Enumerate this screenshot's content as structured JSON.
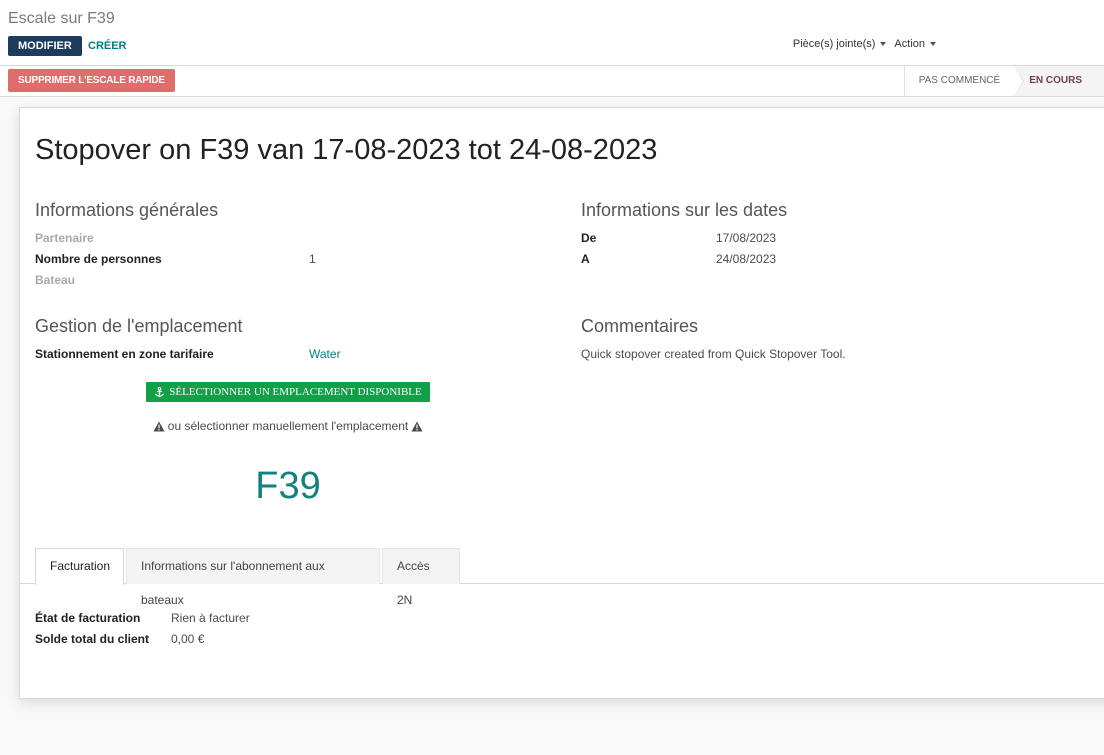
{
  "breadcrumb": "Escale sur F39",
  "toolbar": {
    "modifier": "MODIFIER",
    "creer": "CRÉER",
    "attachments": "Pièce(s) jointe(s)",
    "action": "Action"
  },
  "statusbar": {
    "delete_button": "SUPPRIMER L'ESCALE RAPIDE",
    "stages": [
      "PAS COMMENCÉ",
      "EN COURS"
    ],
    "current_stage": "EN COURS"
  },
  "record": {
    "title": "Stopover on F39 van 17-08-2023 tot 24-08-2023",
    "general": {
      "heading": "Informations générales",
      "partner_label": "Partenaire",
      "persons_label": "Nombre de personnes",
      "persons_value": "1",
      "boat_label": "Bateau"
    },
    "dates": {
      "heading": "Informations sur les dates",
      "from_label": "De",
      "from_value": "17/08/2023",
      "to_label": "A",
      "to_value": "24/08/2023"
    },
    "location": {
      "heading": "Gestion de l'emplacement",
      "zone_label": "Stationnement en zone tarifaire",
      "zone_value": "Water",
      "select_button": "SÉLECTIONNER UN EMPLACEMENT DISPONIBLE",
      "manual_note": "ou sélectionner manuellement l'emplacement",
      "location_code": "F39"
    },
    "comments": {
      "heading": "Commentaires",
      "text": "Quick stopover created from Quick Stopover Tool."
    }
  },
  "tabs": [
    {
      "label": "Facturation"
    },
    {
      "label": "Informations sur l'abonnement aux bateaux"
    },
    {
      "label": "Accès 2N"
    }
  ],
  "billing": {
    "state_label": "État de facturation",
    "state_value": "Rien à facturer",
    "balance_label": "Solde total du client",
    "balance_value": "0,00 €"
  },
  "colors": {
    "primary": "#1c3b5e",
    "link": "#017e84",
    "danger": "#e06c6c",
    "success": "#139e48",
    "stage_active": "#6e3d5c"
  }
}
